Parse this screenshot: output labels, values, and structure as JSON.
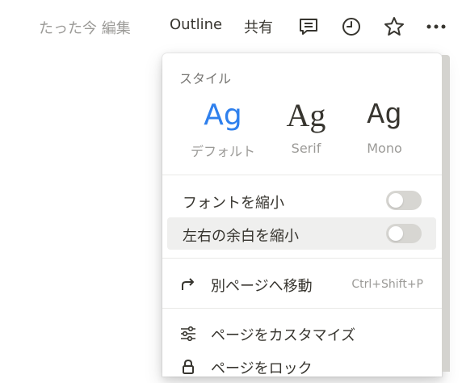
{
  "topbar": {
    "edited_status": "たった今 編集",
    "outline_label": "Outline",
    "share_label": "共有",
    "icons": [
      "comment-icon",
      "history-icon",
      "star-icon",
      "more-icon"
    ]
  },
  "menu": {
    "style_section_label": "スタイル",
    "styles": [
      {
        "sample": "Ag",
        "name": "デフォルト",
        "selected": true
      },
      {
        "sample": "Ag",
        "name": "Serif",
        "selected": false
      },
      {
        "sample": "Ag",
        "name": "Mono",
        "selected": false
      }
    ],
    "toggles": [
      {
        "label": "フォントを縮小",
        "on": false
      },
      {
        "label": "左右の余白を縮小",
        "on": false
      }
    ],
    "items": [
      {
        "icon": "arrow-turn-right-icon",
        "label": "別ページへ移動",
        "shortcut": "Ctrl+Shift+P"
      },
      {
        "icon": "sliders-icon",
        "label": "ページをカスタマイズ"
      },
      {
        "icon": "lock-icon",
        "label": "ページをロック"
      }
    ]
  },
  "colors": {
    "accent": "#2f80ed",
    "text": "#37352f",
    "muted": "#9b9a97",
    "hover": "#efefee",
    "toggle_off": "#d7d6d2"
  }
}
